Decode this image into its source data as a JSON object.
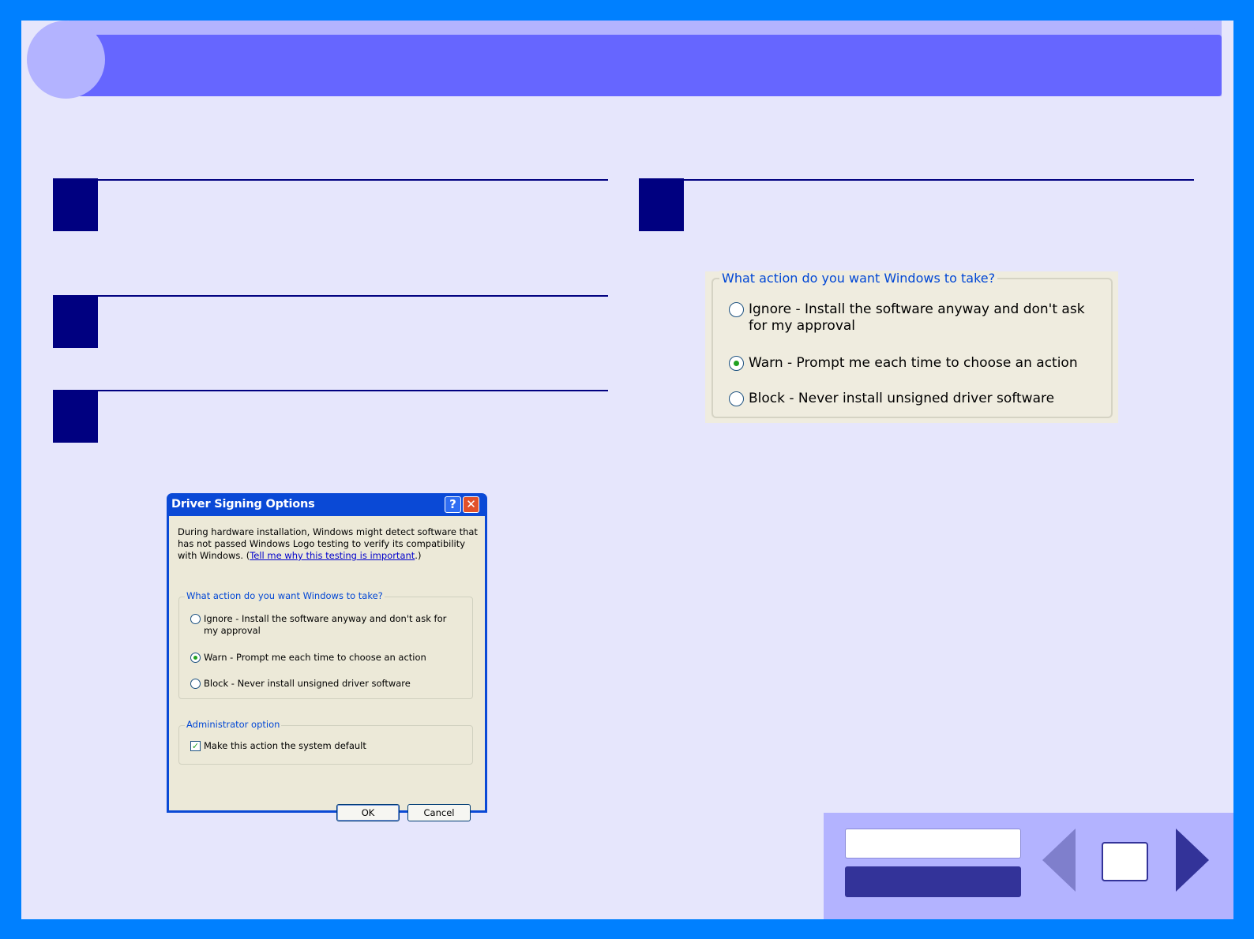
{
  "dialog": {
    "title": "Driver Signing Options",
    "help_glyph": "?",
    "close_glyph": "✕",
    "intro_before_link": "During hardware installation, Windows might detect software that has not passed Windows Logo testing to verify its compatibility with Windows. (",
    "intro_link": "Tell me why this testing is important",
    "intro_after_link": ".)",
    "action_group": {
      "legend": "What action do you want Windows to take?",
      "options": [
        {
          "label": "Ignore - Install the software anyway and don't ask for my approval",
          "selected": false
        },
        {
          "label": "Warn - Prompt me each time to choose an action",
          "selected": true
        },
        {
          "label": "Block - Never install unsigned driver software",
          "selected": false
        }
      ]
    },
    "admin_group": {
      "legend": "Administrator option",
      "checkbox_label": "Make this action the system default",
      "checked": true
    },
    "ok_label": "OK",
    "cancel_label": "Cancel"
  },
  "zoom_group": {
    "legend": "What action do you want Windows to take?",
    "options": [
      {
        "label": "Ignore - Install the software anyway and don't ask for my approval",
        "selected": false
      },
      {
        "label": "Warn - Prompt me each time to choose an action",
        "selected": true
      },
      {
        "label": "Block - Never install unsigned driver software",
        "selected": false
      }
    ]
  },
  "colors": {
    "background": "#0080ff",
    "page": "#e6e6fc",
    "banner": "#6666ff",
    "banner_light": "#b3b3ff",
    "step_marker": "#000080",
    "nav_dark": "#333399"
  }
}
